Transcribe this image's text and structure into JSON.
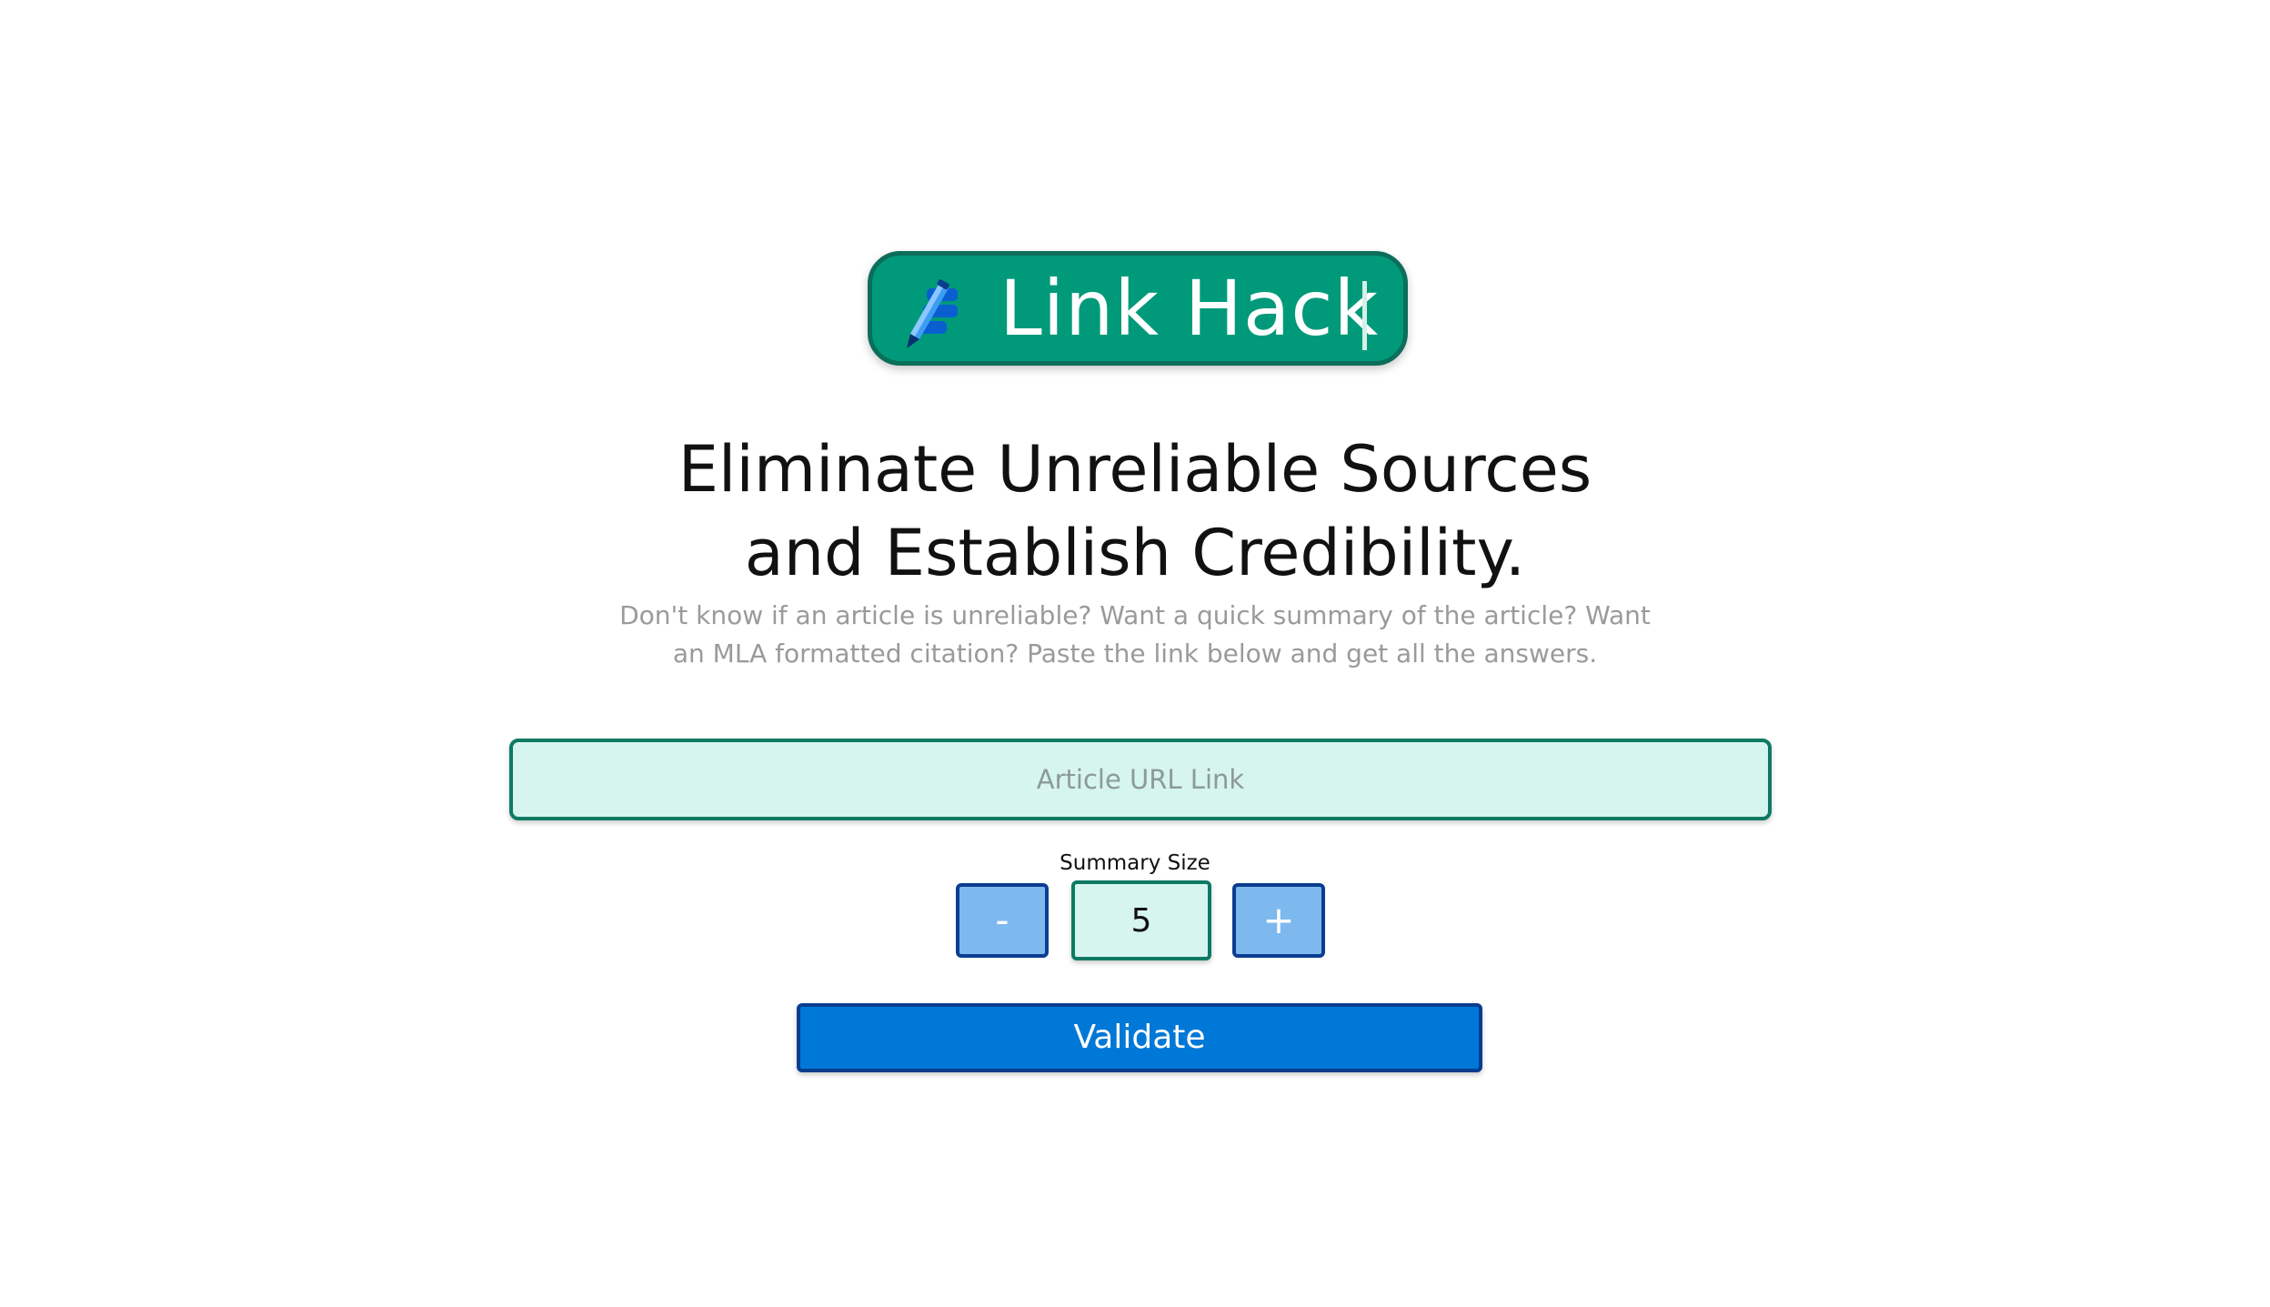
{
  "logo": {
    "text": "Link Hack",
    "icon": "pencil-icon",
    "background_color": "#009a7a",
    "border_color": "#0b6e5a"
  },
  "hero": {
    "headline_line1": "Eliminate Unreliable Sources",
    "headline_line2": "and Establish Credibility.",
    "subtext": "Don't know if an article is unreliable? Want a quick summary of the article? Want an MLA formatted citation? Paste the link below and get all the answers."
  },
  "url_input": {
    "placeholder": "Article URL Link",
    "value": ""
  },
  "summary": {
    "label": "Summary Size",
    "value": "5",
    "decrement_label": "-",
    "increment_label": "+"
  },
  "validate": {
    "label": "Validate",
    "color": "#0078d7"
  }
}
